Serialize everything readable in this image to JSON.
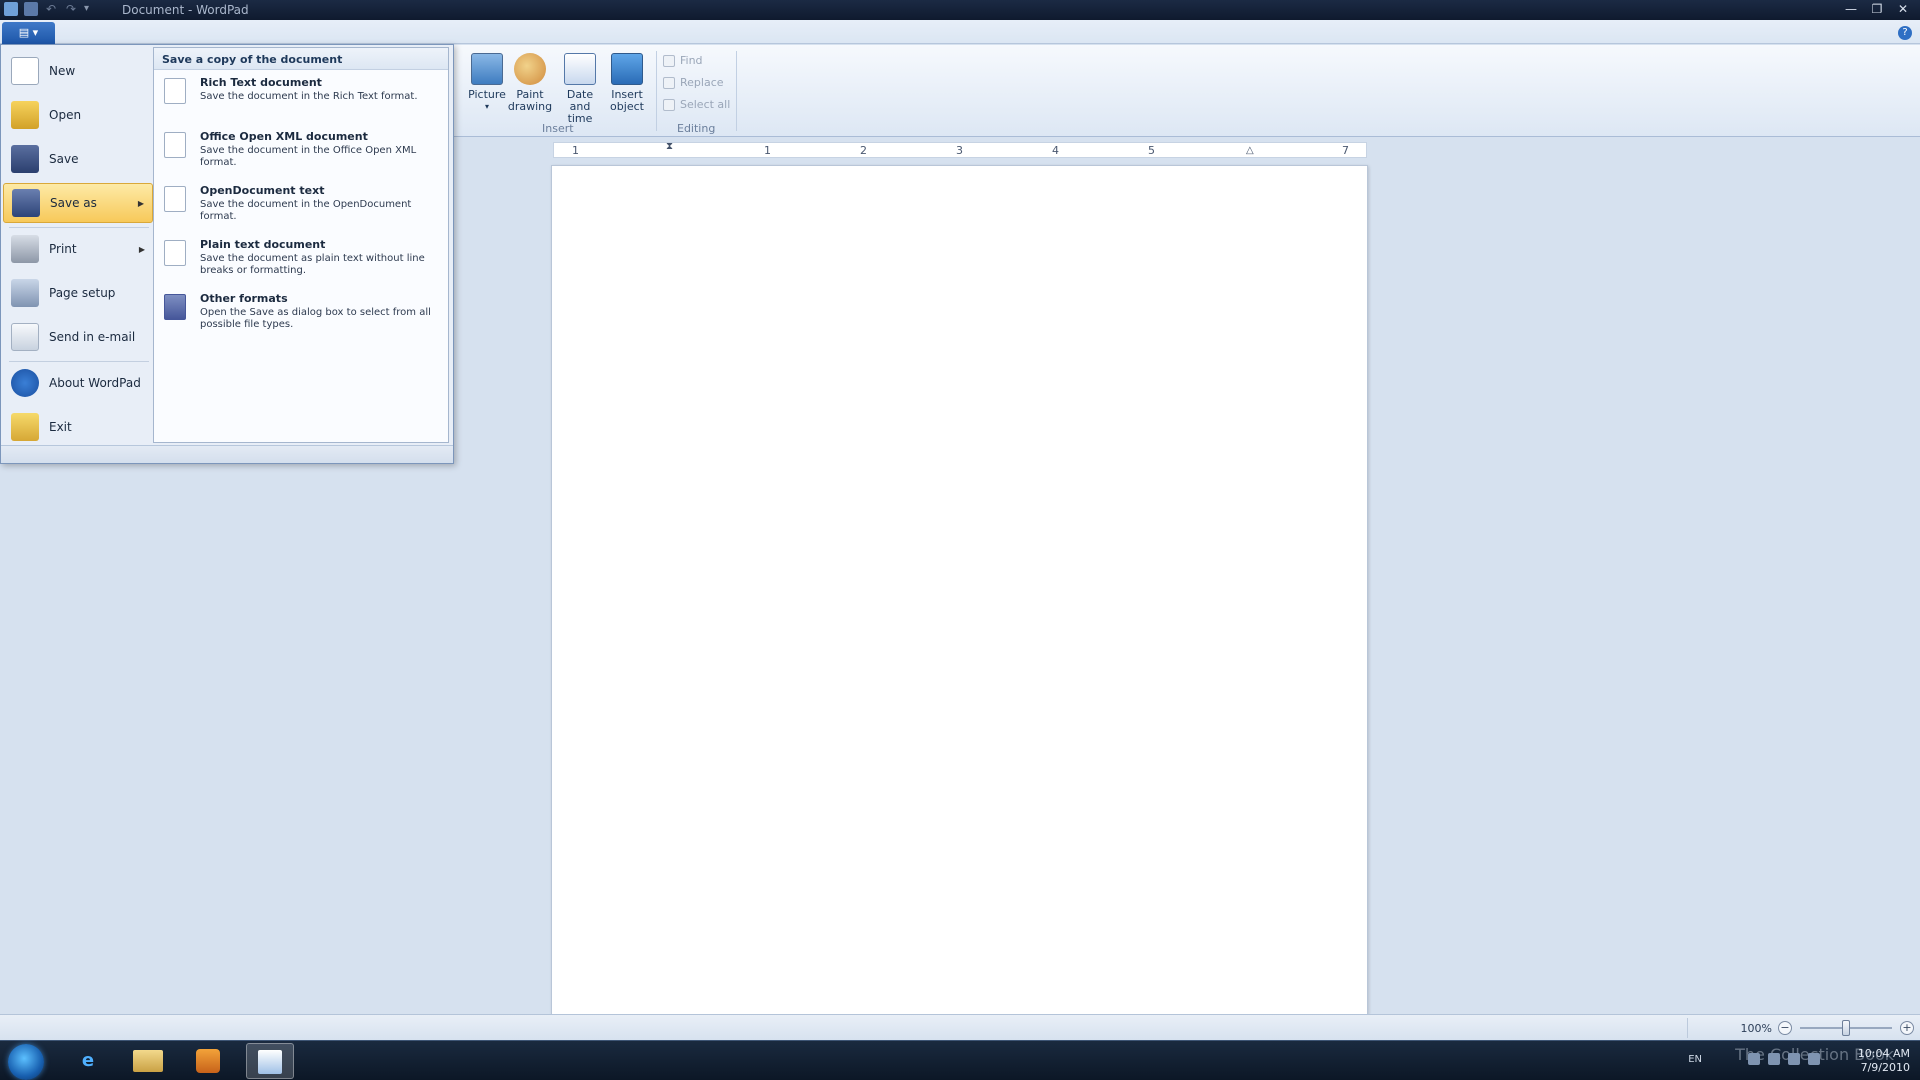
{
  "window": {
    "title": "Document - WordPad",
    "help": "?"
  },
  "app_button": {
    "label": "▤ ▾"
  },
  "ribbon": {
    "insert": {
      "picture": "Picture",
      "picture_arrow": "▾",
      "paint": "Paint drawing",
      "datetime": "Date and time",
      "object": "Insert object",
      "group_label": "Insert"
    },
    "editing": {
      "find": "Find",
      "replace": "Replace",
      "select_all": "Select all",
      "group_label": "Editing"
    }
  },
  "ruler": {
    "numbers": [
      "1",
      "1",
      "2",
      "3",
      "4",
      "5",
      "7"
    ]
  },
  "app_menu": {
    "items": [
      {
        "label": "New"
      },
      {
        "label": "Open"
      },
      {
        "label": "Save"
      },
      {
        "label": "Save as"
      },
      {
        "label": "Print"
      },
      {
        "label": "Page setup"
      },
      {
        "label": "Send in e-mail"
      },
      {
        "label": "About WordPad"
      },
      {
        "label": "Exit"
      }
    ],
    "submenu": {
      "header": "Save a copy of the document",
      "items": [
        {
          "title": "Rich Text document",
          "desc": "Save the document in the Rich Text format."
        },
        {
          "title": "Office Open XML document",
          "desc": "Save the document in the Office Open XML format."
        },
        {
          "title": "OpenDocument text",
          "desc": "Save the document in the OpenDocument format."
        },
        {
          "title": "Plain text document",
          "desc": "Save the document as plain text without line breaks or formatting."
        },
        {
          "title": "Other formats",
          "desc": "Open the Save as dialog box to select from all possible file types."
        }
      ]
    }
  },
  "status": {
    "zoom": "100%",
    "zoom_level": 1.0
  },
  "taskbar": {
    "lang": "EN",
    "time": "10:04 AM",
    "date": "7/9/2010",
    "watermark": "The Collection Book"
  },
  "colors": {
    "accent": "#1d56a8",
    "selection": "#f7c95a",
    "taskbar": "#0c1726"
  }
}
